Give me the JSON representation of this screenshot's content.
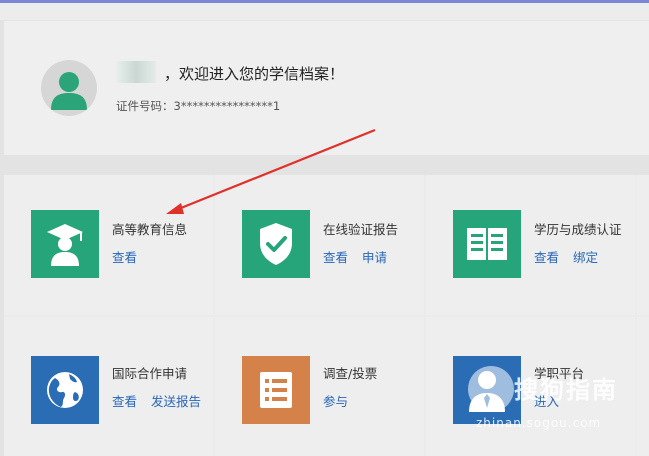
{
  "profile": {
    "welcome": "，欢迎进入您的学信档案！",
    "id_line": "证件号码：3****************1"
  },
  "services": [
    {
      "title": "高等教育信息",
      "links": [
        "查看"
      ],
      "icon": "graduate-icon",
      "color": "#26a47a"
    },
    {
      "title": "在线验证报告",
      "links": [
        "查看",
        "申请"
      ],
      "icon": "shield-check-icon",
      "color": "#26a47a"
    },
    {
      "title": "学历与成绩认证",
      "links": [
        "查看",
        "绑定"
      ],
      "icon": "open-book-icon",
      "color": "#26a47a"
    },
    {
      "title": "国际合作申请",
      "links": [
        "查看",
        "发送报告"
      ],
      "icon": "globe-icon",
      "color": "#2a6db5"
    },
    {
      "title": "调查/投票",
      "links": [
        "参与"
      ],
      "icon": "list-icon",
      "color": "#d5824a"
    },
    {
      "title": "学职平台",
      "links": [
        "进入"
      ],
      "icon": "person-tie-icon",
      "color": "#2a6db5"
    }
  ],
  "watermark": {
    "main": "搜狗指南",
    "sub": "zhinan.sogou.com"
  }
}
